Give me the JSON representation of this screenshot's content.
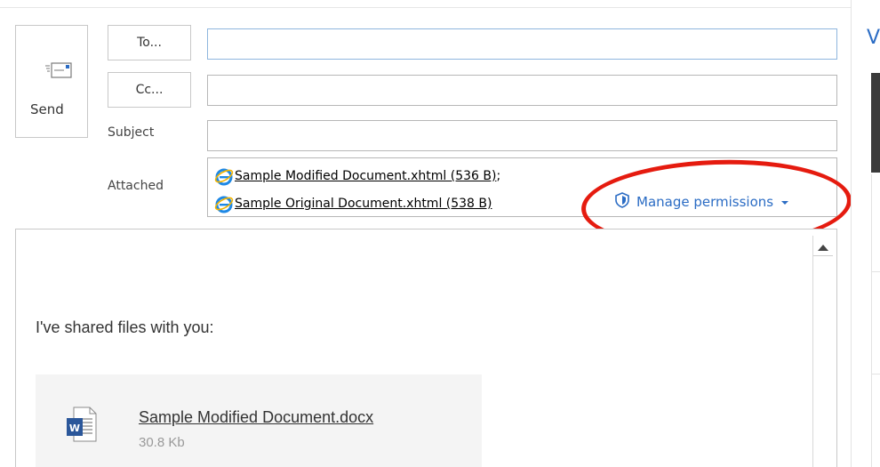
{
  "compose": {
    "send_label": "Send",
    "to_label": "To...",
    "cc_label": "Cc...",
    "subject_label": "Subject",
    "attached_label": "Attached",
    "to_value": "",
    "cc_value": "",
    "subject_value": ""
  },
  "attachments": [
    {
      "name": "Sample Modified Document.xhtml (536 B)",
      "suffix": ";"
    },
    {
      "name": "Sample Original Document.xhtml (538 B)",
      "suffix": ""
    }
  ],
  "permissions": {
    "label": "Manage permissions",
    "icon": "shield-icon"
  },
  "message": {
    "intro": "I've shared files with you:",
    "file": {
      "name": "Sample Modified Document.docx",
      "size": "30.8 Kb",
      "icon": "word-doc-icon"
    }
  },
  "right_pane": {
    "letter": "V"
  },
  "colors": {
    "accent": "#2b6cc4",
    "highlight_circle": "#e51b0f",
    "word_blue": "#2b579a"
  }
}
